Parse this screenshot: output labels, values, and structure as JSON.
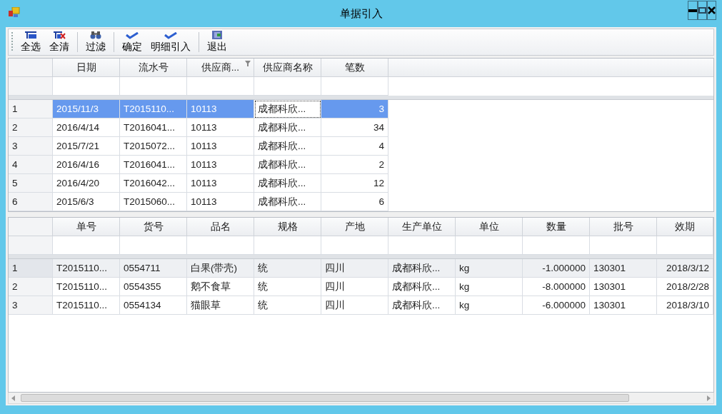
{
  "window": {
    "title": "单据引入"
  },
  "toolbar": [
    {
      "label": "全选",
      "kind": "select-all"
    },
    {
      "label": "全清",
      "kind": "clear-all"
    },
    {
      "label": "过滤",
      "kind": "filter",
      "separator_before": true
    },
    {
      "label": "确定",
      "kind": "confirm",
      "separator_before": true
    },
    {
      "label": "明细引入",
      "kind": "confirm",
      "separator_before": false
    },
    {
      "label": "退出",
      "kind": "exit",
      "separator_before": true
    }
  ],
  "master_grid": {
    "columns": [
      {
        "label": "日期",
        "kind": "text",
        "filtered": false,
        "focused": false
      },
      {
        "label": "流水号",
        "kind": "text",
        "filtered": false,
        "focused": false
      },
      {
        "label": "供应商...",
        "kind": "text",
        "filtered": true,
        "focused": false
      },
      {
        "label": "供应商名称",
        "kind": "text",
        "filtered": false,
        "focused": true
      },
      {
        "label": "笔数",
        "kind": "number",
        "filtered": false,
        "focused": false
      }
    ],
    "rows": [
      {
        "number": "1",
        "cells": [
          "2015/11/3",
          "T2015110...",
          "10113",
          "成都科欣...",
          "3"
        ],
        "selected": true,
        "focused": true
      },
      {
        "number": "2",
        "cells": [
          "2016/4/14",
          "T2016041...",
          "10113",
          "成都科欣...",
          "34"
        ],
        "selected": false,
        "focused": false
      },
      {
        "number": "3",
        "cells": [
          "2015/7/21",
          "T2015072...",
          "10113",
          "成都科欣...",
          "4"
        ],
        "selected": false,
        "focused": false
      },
      {
        "number": "4",
        "cells": [
          "2016/4/16",
          "T2016041...",
          "10113",
          "成都科欣...",
          "2"
        ],
        "selected": false,
        "focused": false
      },
      {
        "number": "5",
        "cells": [
          "2016/4/20",
          "T2016042...",
          "10113",
          "成都科欣...",
          "12"
        ],
        "selected": false,
        "focused": false
      },
      {
        "number": "6",
        "cells": [
          "2015/6/3",
          "T2015060...",
          "10113",
          "成都科欣...",
          "6"
        ],
        "selected": false,
        "focused": false
      }
    ]
  },
  "detail_grid": {
    "columns": [
      {
        "label": "单号",
        "kind": "text"
      },
      {
        "label": "货号",
        "kind": "text"
      },
      {
        "label": "品名",
        "kind": "text"
      },
      {
        "label": "规格",
        "kind": "text"
      },
      {
        "label": "产地",
        "kind": "text"
      },
      {
        "label": "生产单位",
        "kind": "text"
      },
      {
        "label": "单位",
        "kind": "text"
      },
      {
        "label": "数量",
        "kind": "number"
      },
      {
        "label": "批号",
        "kind": "text"
      },
      {
        "label": "效期",
        "kind": "number"
      }
    ],
    "rows": [
      {
        "number": "1",
        "cells": [
          "T2015110...",
          "0554711",
          "白果(带壳)",
          "统",
          "四川",
          "成都科欣...",
          "kg",
          "-1.000000",
          "130301",
          "2018/3/12"
        ],
        "current": true
      },
      {
        "number": "2",
        "cells": [
          "T2015110...",
          "0554355",
          "鹅不食草",
          "统",
          "四川",
          "成都科欣...",
          "kg",
          "-8.000000",
          "130301",
          "2018/2/28"
        ],
        "current": false
      },
      {
        "number": "3",
        "cells": [
          "T2015110...",
          "0554134",
          "猫眼草",
          "统",
          "四川",
          "成都科欣...",
          "kg",
          "-6.000000",
          "130301",
          "2018/3/10"
        ],
        "current": false
      }
    ]
  }
}
